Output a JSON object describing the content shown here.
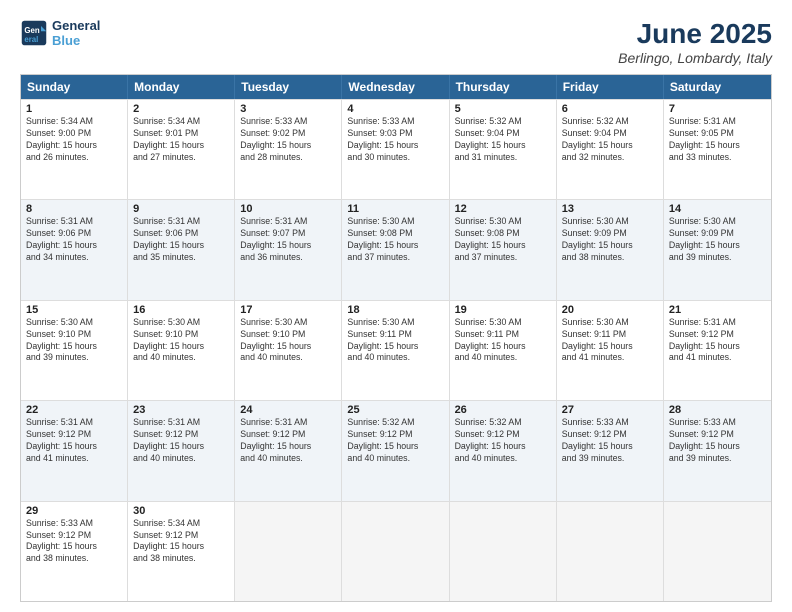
{
  "logo": {
    "line1": "General",
    "line2": "Blue"
  },
  "title": "June 2025",
  "location": "Berlingo, Lombardy, Italy",
  "weekdays": [
    "Sunday",
    "Monday",
    "Tuesday",
    "Wednesday",
    "Thursday",
    "Friday",
    "Saturday"
  ],
  "rows": [
    [
      {
        "day": "1",
        "text": "Sunrise: 5:34 AM\nSunset: 9:00 PM\nDaylight: 15 hours\nand 26 minutes."
      },
      {
        "day": "2",
        "text": "Sunrise: 5:34 AM\nSunset: 9:01 PM\nDaylight: 15 hours\nand 27 minutes."
      },
      {
        "day": "3",
        "text": "Sunrise: 5:33 AM\nSunset: 9:02 PM\nDaylight: 15 hours\nand 28 minutes."
      },
      {
        "day": "4",
        "text": "Sunrise: 5:33 AM\nSunset: 9:03 PM\nDaylight: 15 hours\nand 30 minutes."
      },
      {
        "day": "5",
        "text": "Sunrise: 5:32 AM\nSunset: 9:04 PM\nDaylight: 15 hours\nand 31 minutes."
      },
      {
        "day": "6",
        "text": "Sunrise: 5:32 AM\nSunset: 9:04 PM\nDaylight: 15 hours\nand 32 minutes."
      },
      {
        "day": "7",
        "text": "Sunrise: 5:31 AM\nSunset: 9:05 PM\nDaylight: 15 hours\nand 33 minutes."
      }
    ],
    [
      {
        "day": "8",
        "text": "Sunrise: 5:31 AM\nSunset: 9:06 PM\nDaylight: 15 hours\nand 34 minutes."
      },
      {
        "day": "9",
        "text": "Sunrise: 5:31 AM\nSunset: 9:06 PM\nDaylight: 15 hours\nand 35 minutes."
      },
      {
        "day": "10",
        "text": "Sunrise: 5:31 AM\nSunset: 9:07 PM\nDaylight: 15 hours\nand 36 minutes."
      },
      {
        "day": "11",
        "text": "Sunrise: 5:30 AM\nSunset: 9:08 PM\nDaylight: 15 hours\nand 37 minutes."
      },
      {
        "day": "12",
        "text": "Sunrise: 5:30 AM\nSunset: 9:08 PM\nDaylight: 15 hours\nand 37 minutes."
      },
      {
        "day": "13",
        "text": "Sunrise: 5:30 AM\nSunset: 9:09 PM\nDaylight: 15 hours\nand 38 minutes."
      },
      {
        "day": "14",
        "text": "Sunrise: 5:30 AM\nSunset: 9:09 PM\nDaylight: 15 hours\nand 39 minutes."
      }
    ],
    [
      {
        "day": "15",
        "text": "Sunrise: 5:30 AM\nSunset: 9:10 PM\nDaylight: 15 hours\nand 39 minutes."
      },
      {
        "day": "16",
        "text": "Sunrise: 5:30 AM\nSunset: 9:10 PM\nDaylight: 15 hours\nand 40 minutes."
      },
      {
        "day": "17",
        "text": "Sunrise: 5:30 AM\nSunset: 9:10 PM\nDaylight: 15 hours\nand 40 minutes."
      },
      {
        "day": "18",
        "text": "Sunrise: 5:30 AM\nSunset: 9:11 PM\nDaylight: 15 hours\nand 40 minutes."
      },
      {
        "day": "19",
        "text": "Sunrise: 5:30 AM\nSunset: 9:11 PM\nDaylight: 15 hours\nand 40 minutes."
      },
      {
        "day": "20",
        "text": "Sunrise: 5:30 AM\nSunset: 9:11 PM\nDaylight: 15 hours\nand 41 minutes."
      },
      {
        "day": "21",
        "text": "Sunrise: 5:31 AM\nSunset: 9:12 PM\nDaylight: 15 hours\nand 41 minutes."
      }
    ],
    [
      {
        "day": "22",
        "text": "Sunrise: 5:31 AM\nSunset: 9:12 PM\nDaylight: 15 hours\nand 41 minutes."
      },
      {
        "day": "23",
        "text": "Sunrise: 5:31 AM\nSunset: 9:12 PM\nDaylight: 15 hours\nand 40 minutes."
      },
      {
        "day": "24",
        "text": "Sunrise: 5:31 AM\nSunset: 9:12 PM\nDaylight: 15 hours\nand 40 minutes."
      },
      {
        "day": "25",
        "text": "Sunrise: 5:32 AM\nSunset: 9:12 PM\nDaylight: 15 hours\nand 40 minutes."
      },
      {
        "day": "26",
        "text": "Sunrise: 5:32 AM\nSunset: 9:12 PM\nDaylight: 15 hours\nand 40 minutes."
      },
      {
        "day": "27",
        "text": "Sunrise: 5:33 AM\nSunset: 9:12 PM\nDaylight: 15 hours\nand 39 minutes."
      },
      {
        "day": "28",
        "text": "Sunrise: 5:33 AM\nSunset: 9:12 PM\nDaylight: 15 hours\nand 39 minutes."
      }
    ],
    [
      {
        "day": "29",
        "text": "Sunrise: 5:33 AM\nSunset: 9:12 PM\nDaylight: 15 hours\nand 38 minutes."
      },
      {
        "day": "30",
        "text": "Sunrise: 5:34 AM\nSunset: 9:12 PM\nDaylight: 15 hours\nand 38 minutes."
      },
      {
        "day": "",
        "text": ""
      },
      {
        "day": "",
        "text": ""
      },
      {
        "day": "",
        "text": ""
      },
      {
        "day": "",
        "text": ""
      },
      {
        "day": "",
        "text": ""
      }
    ]
  ]
}
